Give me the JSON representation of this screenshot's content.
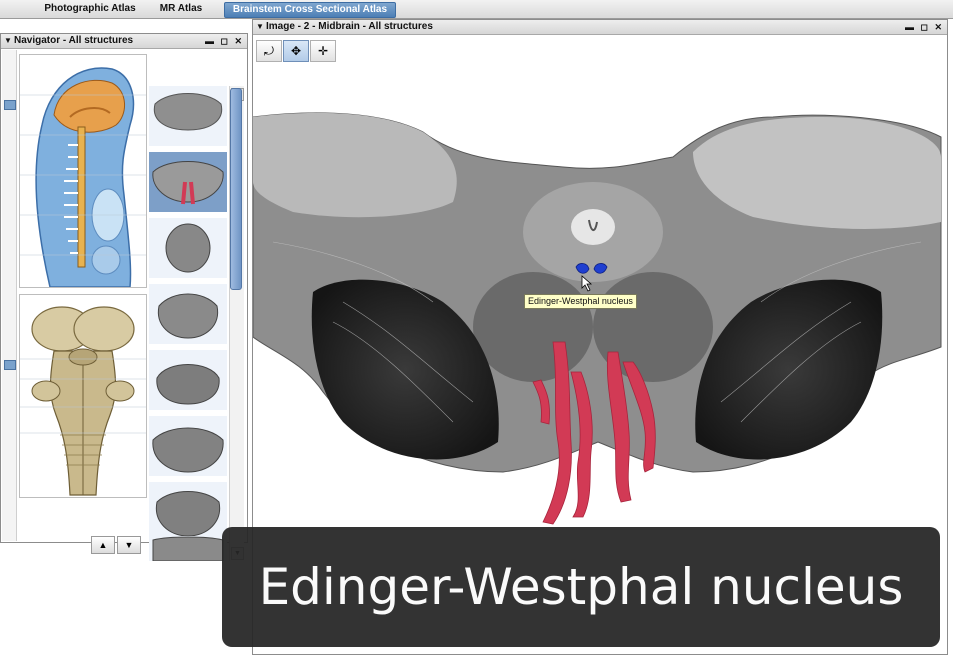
{
  "tabs": [
    {
      "label": "Photographic Atlas"
    },
    {
      "label": "MR Atlas"
    },
    {
      "label": "Brainstem Cross Sectional Atlas"
    }
  ],
  "navigator": {
    "title": "Navigator - All structures",
    "window_buttons": "▬ ◻ ✕"
  },
  "image_panel": {
    "title": "Image - 2 - Midbrain - All structures",
    "window_buttons": "▬ ◻ ✕",
    "tooltip": "Edinger-Westphal nucleus"
  },
  "caption": "Edinger-Westphal nucleus",
  "colors": {
    "accent": "#4d7fb5",
    "highlight_structure": "#d23a55",
    "selected_nucleus": "#1f3fd0"
  },
  "icons": [
    "triangle-down-icon",
    "minimize-icon",
    "maximize-icon",
    "close-icon",
    "reset-view-icon",
    "pan-icon",
    "crosshair-icon",
    "up-arrow-icon",
    "down-arrow-icon"
  ]
}
